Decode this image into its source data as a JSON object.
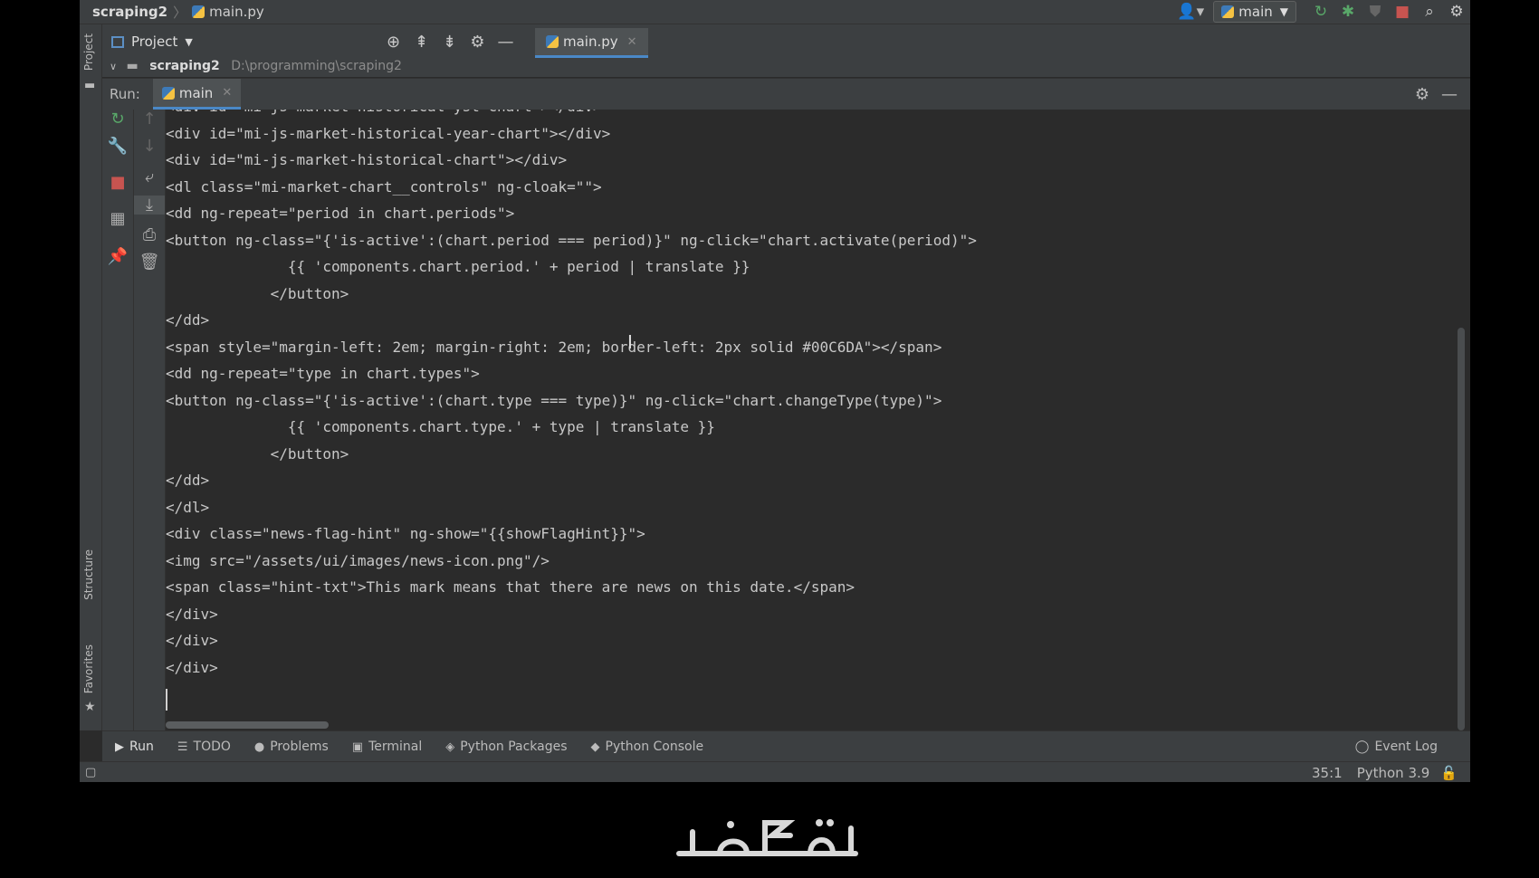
{
  "titlebar": {
    "project": "scraping2",
    "file": "main.py",
    "run_config": "main"
  },
  "project_panel": {
    "title": "Project",
    "root_name": "scraping2",
    "root_path": "D:\\programming\\scraping2"
  },
  "left_strip": {
    "project": "Project",
    "structure": "Structure",
    "favorites": "Favorites"
  },
  "editor_tab": {
    "label": "main.py"
  },
  "run_panel": {
    "label": "Run:",
    "tab": "main"
  },
  "console_lines": [
    "<div id=\"mi-js-market-historical-yst-chart\"></div>",
    "<div id=\"mi-js-market-historical-year-chart\"></div>",
    "<div id=\"mi-js-market-historical-chart\"></div>",
    "<dl class=\"mi-market-chart__controls\" ng-cloak=\"\">",
    "<dd ng-repeat=\"period in chart.periods\">",
    "<button ng-class=\"{'is-active':(chart.period === period)}\" ng-click=\"chart.activate(period)\">",
    "              {{ 'components.chart.period.' + period | translate }}",
    "            </button>",
    "</dd>",
    "<span style=\"margin-left: 2em; margin-right: 2em; border-left: 2px solid #00C6DA\"></span>",
    "<dd ng-repeat=\"type in chart.types\">",
    "<button ng-class=\"{'is-active':(chart.type === type)}\" ng-click=\"chart.changeType(type)\">",
    "              {{ 'components.chart.type.' + type | translate }}",
    "            </button>",
    "</dd>",
    "</dl>",
    "<div class=\"news-flag-hint\" ng-show=\"{{showFlagHint}}\">",
    "<img src=\"/assets/ui/images/news-icon.png\"/>",
    "<span class=\"hint-txt\">This mark means that there are news on this date.</span>",
    "</div>",
    "</div>",
    "</div>"
  ],
  "bottom_tabs": [
    "Run",
    "TODO",
    "Problems",
    "Terminal",
    "Python Packages",
    "Python Console"
  ],
  "event_log": "Event Log",
  "status": {
    "position": "35:1",
    "interpreter": "Python 3.9"
  },
  "colors": {
    "bg": "#2b2b2b",
    "panel": "#3c3f41",
    "accent": "#4a88c7",
    "stop": "#c75450",
    "run": "#59a869"
  }
}
